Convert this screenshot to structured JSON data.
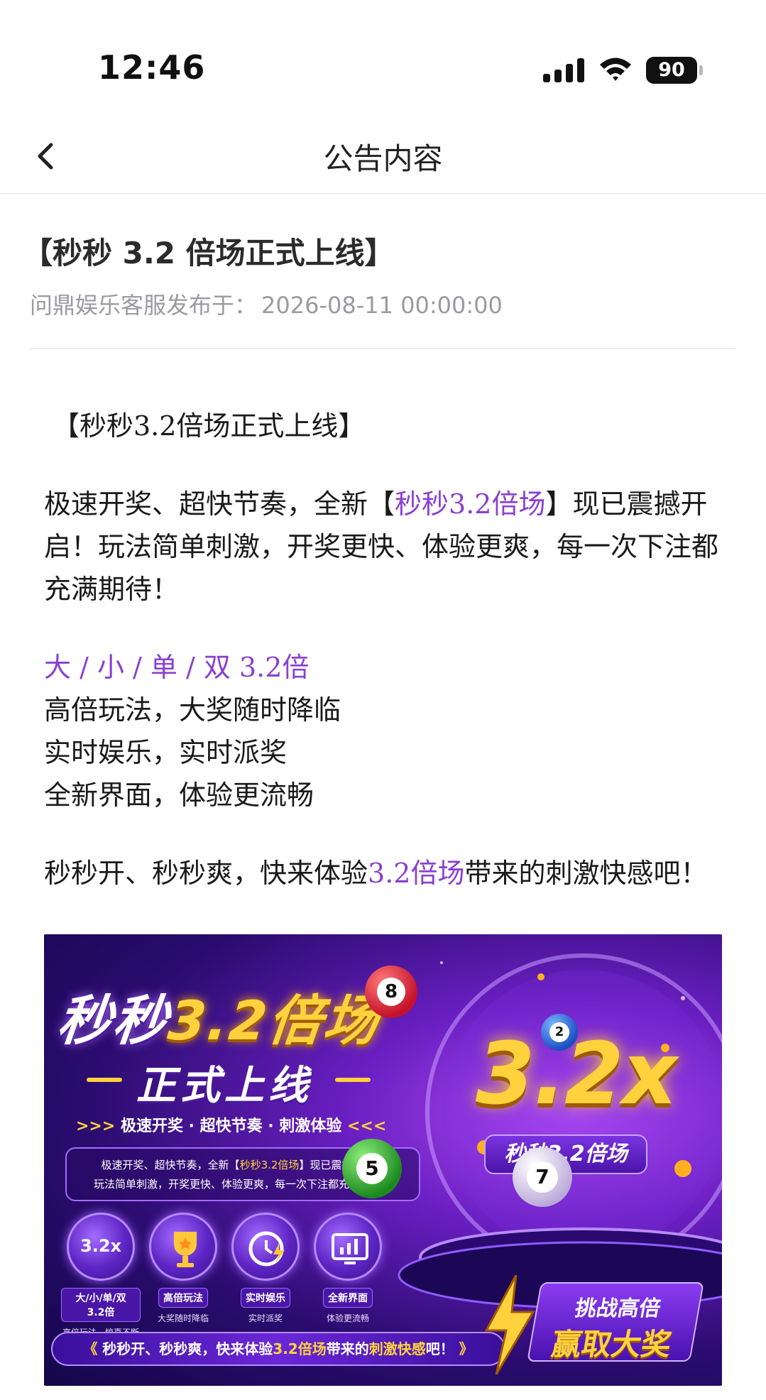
{
  "status_bar": {
    "time": "12:46",
    "battery": "90"
  },
  "nav": {
    "title": "公告内容"
  },
  "post": {
    "title": "【秒秒 3.2 倍场正式上线】",
    "publisher": "问鼎娱乐客服发布于：",
    "date": "2026-08-11 00:00:00"
  },
  "body": {
    "heading": "【秒秒3.2倍场正式上线】",
    "intro_1": "极速开奖、超快节奏，全新【",
    "intro_highlight": "秒秒3.2倍场",
    "intro_2": "】现已震撼开启！玩法简单刺激，开奖更快、体验更爽，每一次下注都充满期待！",
    "odds_line": "大 / 小 / 单 / 双 3.2倍",
    "features": [
      "高倍玩法，大奖随时降临",
      "实时娱乐，实时派奖",
      "全新界面，体验更流畅"
    ],
    "outro_1": "秒秒开、秒秒爽，快来体验",
    "outro_highlight": "3.2倍场",
    "outro_2": "带来的刺激快感吧！"
  },
  "banner": {
    "title_white": "秒秒",
    "title_gold": "3.2倍场",
    "subtitle": "正式上线",
    "tagline": "极速开奖 · 超快节奏 · 刺激体验",
    "desc_line1_a": "极速开奖、超快节奏，全新【",
    "desc_line1_hl": "秒秒3.2倍场",
    "desc_line1_b": "】现已震撼开启！",
    "desc_line2": "玩法简单刺激，开奖更快、体验更爽，每一次下注都充满期待！",
    "feature_items": [
      {
        "icon_text": "3.2x",
        "label": "大/小/单/双 3.2倍",
        "caption": "高倍玩法，惊喜不断"
      },
      {
        "icon_text": "",
        "label": "高倍玩法",
        "caption": "大奖随时降临"
      },
      {
        "icon_text": "",
        "label": "实时娱乐",
        "caption": "实时派奖"
      },
      {
        "icon_text": "",
        "label": "全新界面",
        "caption": "体验更流畅"
      }
    ],
    "bottom_a": "秒秒开、秒秒爽，快来体验",
    "bottom_hl": "3.2倍场",
    "bottom_b": "带来的",
    "bottom_hl2": "刺激快感",
    "bottom_c": "吧！",
    "big_multiplier": "3.2x",
    "pill": "秒秒3.2倍场",
    "balls": [
      "8",
      "2",
      "5",
      "7"
    ],
    "challenge_l1": "挑战高倍",
    "challenge_l2": "赢取大奖"
  },
  "colors": {
    "accent_purple": "#8a3fd1",
    "gold": "#ffd23d"
  }
}
